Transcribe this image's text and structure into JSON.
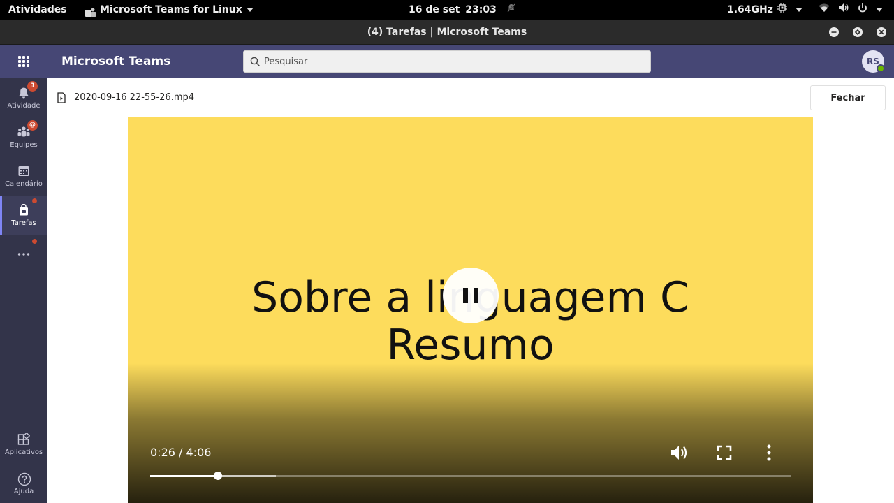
{
  "topbar": {
    "activities": "Atividades",
    "app_menu": "Microsoft Teams for Linux",
    "date": "16 de set",
    "time": "23:03",
    "cpu_freq": "1.64GHz",
    "icons": [
      "notifications-muted-icon",
      "cpu-icon",
      "wifi-icon",
      "volume-icon",
      "power-icon"
    ]
  },
  "window": {
    "title": "(4) Tarefas | Microsoft Teams",
    "buttons": [
      "minimize",
      "maximize",
      "close"
    ]
  },
  "header": {
    "brand": "Microsoft Teams",
    "search_placeholder": "Pesquisar",
    "avatar_initials": "RS",
    "presence": "available"
  },
  "rail": {
    "items": [
      {
        "label": "Atividade",
        "icon": "bell-icon",
        "badge": "3"
      },
      {
        "label": "Equipes",
        "icon": "teams-icon",
        "badge": "@"
      },
      {
        "label": "Calendário",
        "icon": "calendar-icon"
      },
      {
        "label": "Tarefas",
        "icon": "assignments-icon",
        "active": true,
        "dot": true
      },
      {
        "label": "",
        "icon": "more-icon",
        "dot": true
      }
    ],
    "bottom": [
      {
        "label": "Aplicativos",
        "icon": "apps-icon"
      },
      {
        "label": "Ajuda",
        "icon": "help-icon"
      }
    ]
  },
  "file": {
    "name": "2020-09-16 22-55-26.mp4",
    "close_label": "Fechar"
  },
  "video": {
    "slide_line1": "Sobre a linguagem C",
    "slide_line2": "Resumo",
    "current_time": "0:26",
    "duration": "4:06",
    "time_display": "0:26 / 4:06",
    "progress_fraction": 0.1057,
    "buffered_fraction": 0.196,
    "state": "playing",
    "background_color": "#fddc5c"
  },
  "colors": {
    "teams_purple": "#464775",
    "rail_bg": "#33344a",
    "badge_red": "#cc4a31"
  }
}
